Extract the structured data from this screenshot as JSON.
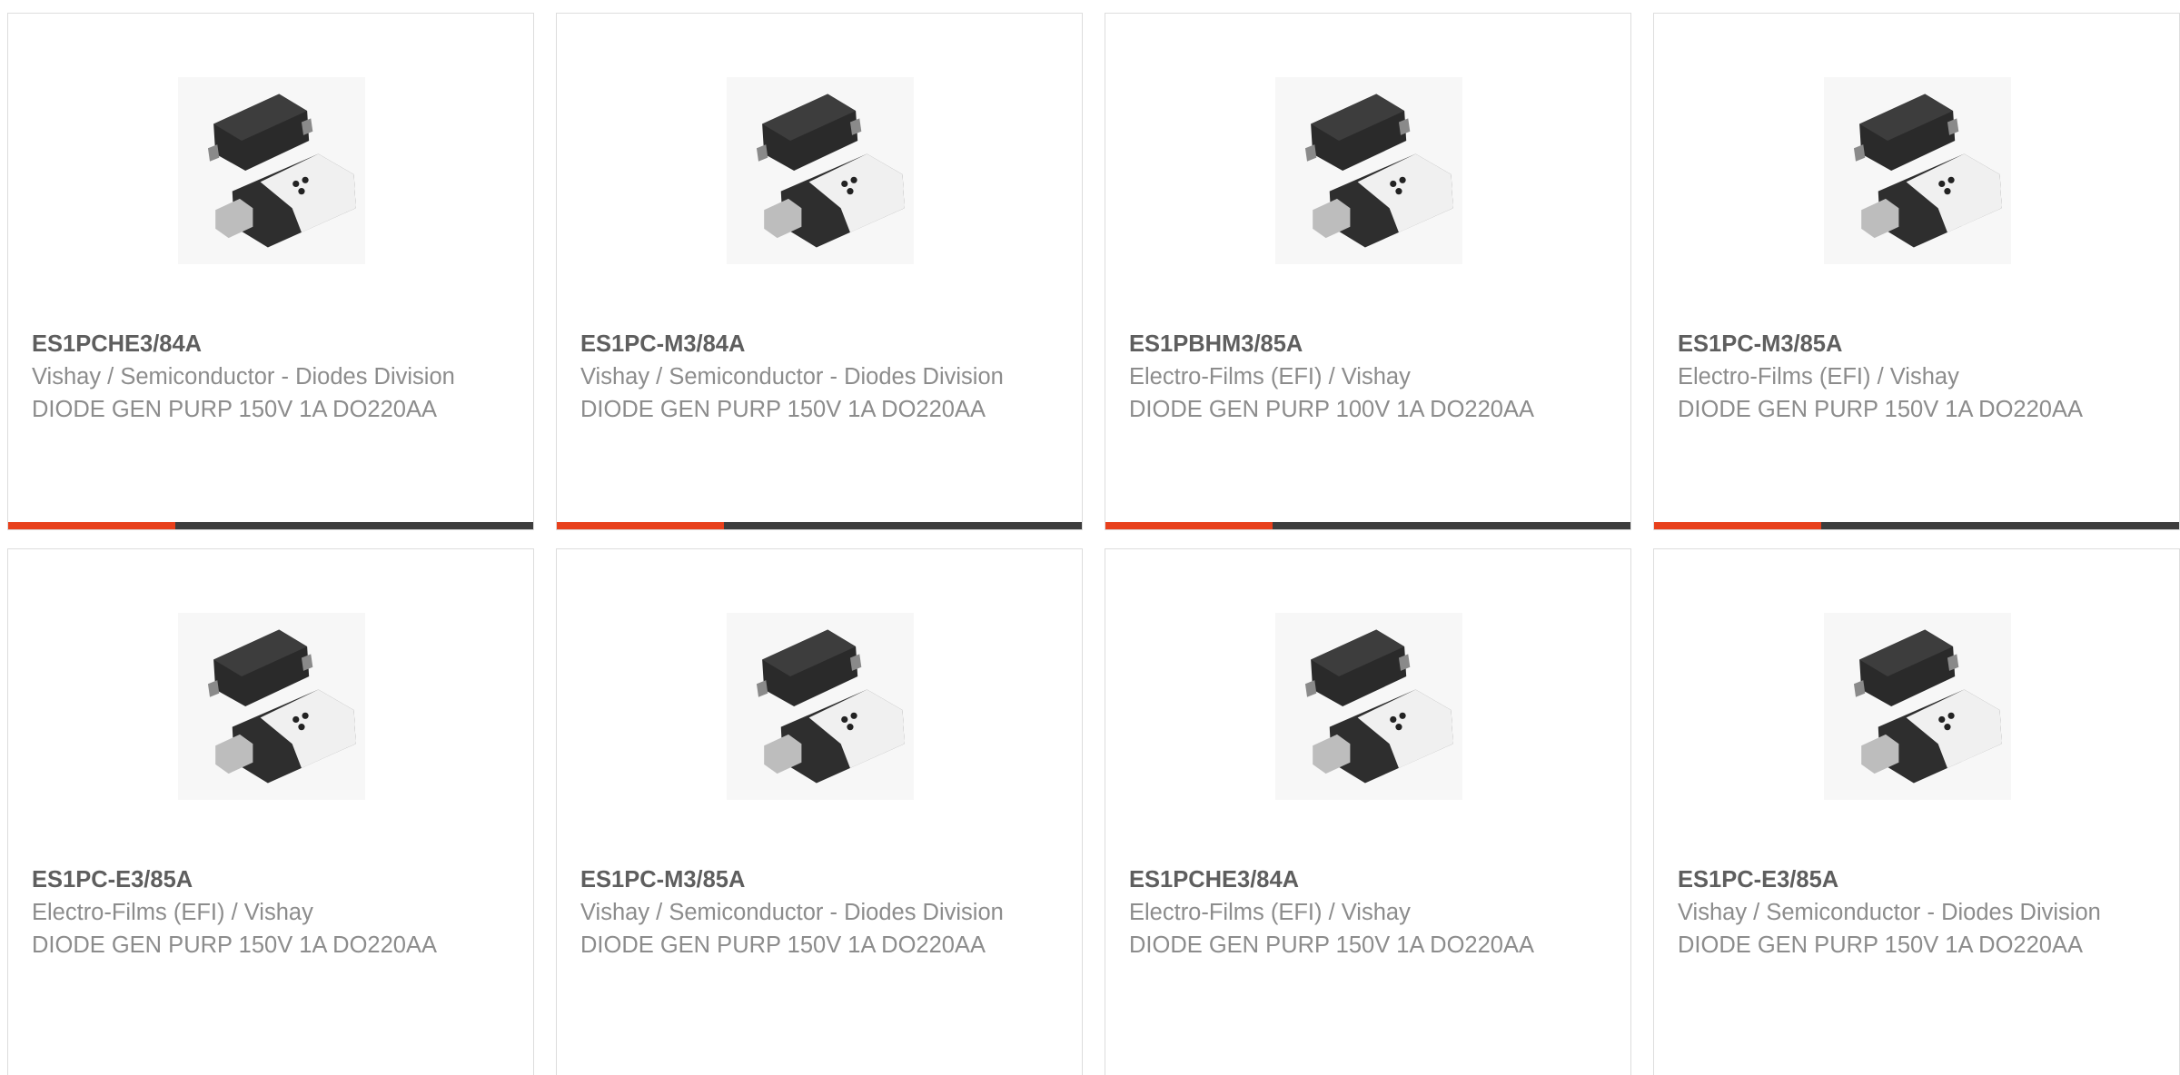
{
  "theme": {
    "accent": "#e8401c",
    "bar": "#3d3d3d"
  },
  "products": [
    {
      "part_number": "ES1PCHE3/84A",
      "manufacturer": "Vishay / Semiconductor - Diodes Division",
      "description": "DIODE GEN PURP 150V 1A DO220AA",
      "image": "diode-package-icon"
    },
    {
      "part_number": "ES1PC-M3/84A",
      "manufacturer": "Vishay / Semiconductor - Diodes Division",
      "description": "DIODE GEN PURP 150V 1A DO220AA",
      "image": "diode-package-icon"
    },
    {
      "part_number": "ES1PBHM3/85A",
      "manufacturer": "Electro-Films (EFI) / Vishay",
      "description": "DIODE GEN PURP 100V 1A DO220AA",
      "image": "diode-package-icon"
    },
    {
      "part_number": "ES1PC-M3/85A",
      "manufacturer": "Electro-Films (EFI) / Vishay",
      "description": "DIODE GEN PURP 150V 1A DO220AA",
      "image": "diode-package-icon"
    },
    {
      "part_number": "ES1PC-E3/85A",
      "manufacturer": "Electro-Films (EFI) / Vishay",
      "description": "DIODE GEN PURP 150V 1A DO220AA",
      "image": "diode-package-icon"
    },
    {
      "part_number": "ES1PC-M3/85A",
      "manufacturer": "Vishay / Semiconductor - Diodes Division",
      "description": "DIODE GEN PURP 150V 1A DO220AA",
      "image": "diode-package-icon"
    },
    {
      "part_number": "ES1PCHE3/84A",
      "manufacturer": "Electro-Films (EFI) / Vishay",
      "description": "DIODE GEN PURP 150V 1A DO220AA",
      "image": "diode-package-icon"
    },
    {
      "part_number": "ES1PC-E3/85A",
      "manufacturer": "Vishay / Semiconductor - Diodes Division",
      "description": "DIODE GEN PURP 150V 1A DO220AA",
      "image": "diode-package-icon"
    }
  ]
}
